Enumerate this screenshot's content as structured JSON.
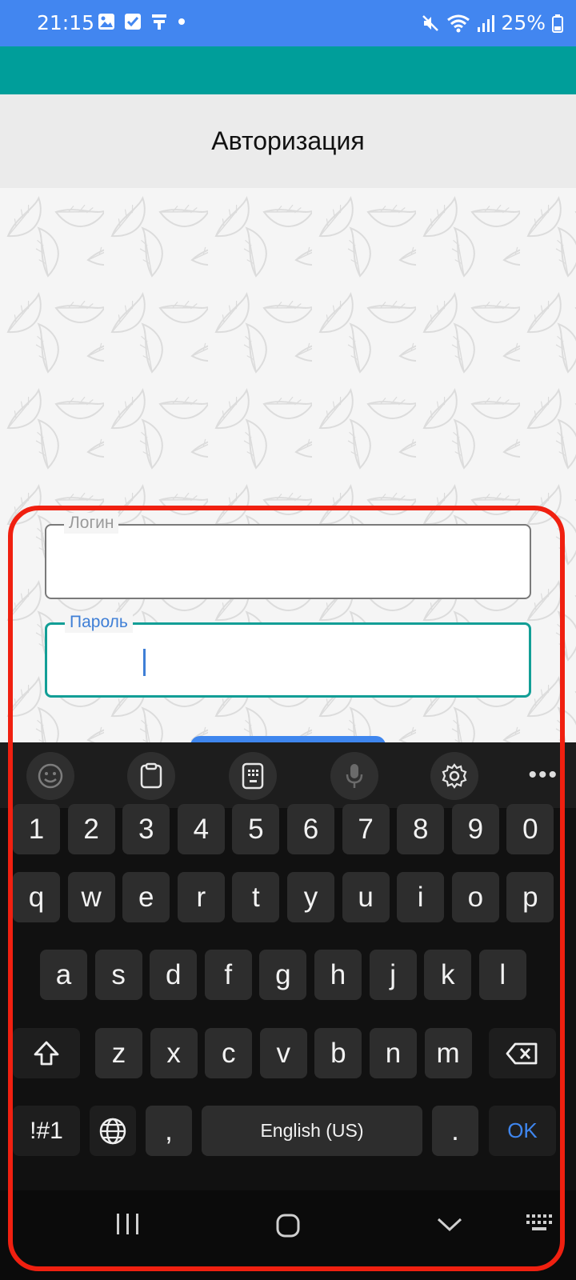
{
  "status_bar": {
    "time": "21:15",
    "battery_percent": "25%",
    "notification_icons": [
      "image-icon",
      "checkbox-icon",
      "app-icon",
      "dot-icon"
    ],
    "system_icons": [
      "mute-icon",
      "wifi-icon",
      "signal-icon",
      "battery-icon"
    ]
  },
  "header": {
    "title": "Авторизация"
  },
  "form": {
    "login": {
      "label": "Логин",
      "value": ""
    },
    "password": {
      "label": "Пароль",
      "value": ""
    }
  },
  "keyboard": {
    "toolbar": [
      "emoji-icon",
      "clipboard-icon",
      "one-handed-keyboard-icon",
      "microphone-icon",
      "settings-icon",
      "more-icon"
    ],
    "row_numbers": [
      "1",
      "2",
      "3",
      "4",
      "5",
      "6",
      "7",
      "8",
      "9",
      "0"
    ],
    "row_1": [
      "q",
      "w",
      "e",
      "r",
      "t",
      "y",
      "u",
      "i",
      "o",
      "p"
    ],
    "row_2": [
      "a",
      "s",
      "d",
      "f",
      "g",
      "h",
      "j",
      "k",
      "l"
    ],
    "row_3": [
      "z",
      "x",
      "c",
      "v",
      "b",
      "n",
      "m"
    ],
    "symbols_label": "!#1",
    "comma": ",",
    "space_label": "English (US)",
    "period": ".",
    "ok_label": "OK"
  },
  "colors": {
    "status_bar": "#4286f0",
    "app_bar": "#009e9a",
    "accent": "#129e96",
    "focus_label": "#3f7fd6",
    "highlight_frame": "#f02010"
  }
}
